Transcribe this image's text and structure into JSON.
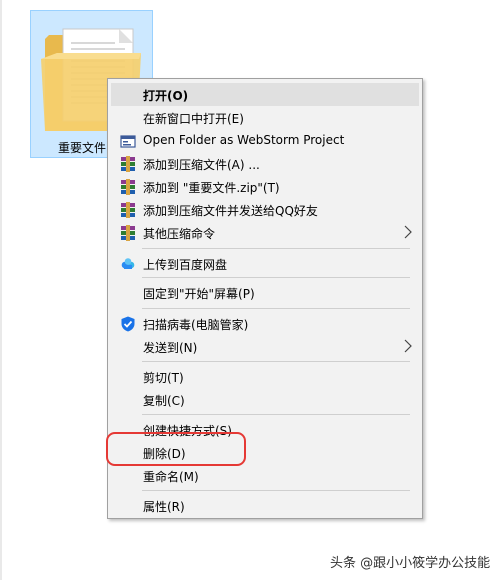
{
  "desktop": {
    "file_label": "重要文件"
  },
  "context_menu": {
    "items": [
      {
        "label": "打开(O)",
        "icon": "",
        "submenu": false,
        "bold": true,
        "hovered": true
      },
      {
        "label": "在新窗口中打开(E)",
        "icon": "",
        "submenu": false
      },
      {
        "label": "Open Folder as WebStorm Project",
        "icon": "webstorm-icon",
        "submenu": false
      },
      {
        "label": "添加到压缩文件(A) ...",
        "icon": "winrar-icon",
        "submenu": false
      },
      {
        "label": "添加到 \"重要文件.zip\"(T)",
        "icon": "winrar-icon",
        "submenu": false
      },
      {
        "label": "添加到压缩文件并发送给QQ好友",
        "icon": "winrar-icon",
        "submenu": false
      },
      {
        "label": "其他压缩命令",
        "icon": "winrar-icon",
        "submenu": true
      },
      {
        "label": "上传到百度网盘",
        "icon": "baidu-netdisk-icon",
        "submenu": false
      },
      {
        "label": "固定到\"开始\"屏幕(P)",
        "icon": "",
        "submenu": false
      },
      {
        "label": "扫描病毒(电脑管家)",
        "icon": "tencent-pc-manager-shield-icon",
        "submenu": false
      },
      {
        "label": "发送到(N)",
        "icon": "",
        "submenu": true
      },
      {
        "label": "剪切(T)",
        "icon": "",
        "submenu": false
      },
      {
        "label": "复制(C)",
        "icon": "",
        "submenu": false
      },
      {
        "label": "创建快捷方式(S)",
        "icon": "",
        "submenu": false
      },
      {
        "label": "删除(D)",
        "icon": "",
        "submenu": false,
        "annotated": true
      },
      {
        "label": "重命名(M)",
        "icon": "",
        "submenu": false
      },
      {
        "label": "属性(R)",
        "icon": "",
        "submenu": false
      }
    ]
  },
  "annotation": {
    "color": "#e53935"
  },
  "watermark": "头条 @跟小小筱学办公技能",
  "colors": {
    "selection_bg": "#cce8ff",
    "selection_border": "#99d1ff",
    "menu_bg": "#f2f2f2",
    "menu_hover": "#e0e0e0"
  }
}
